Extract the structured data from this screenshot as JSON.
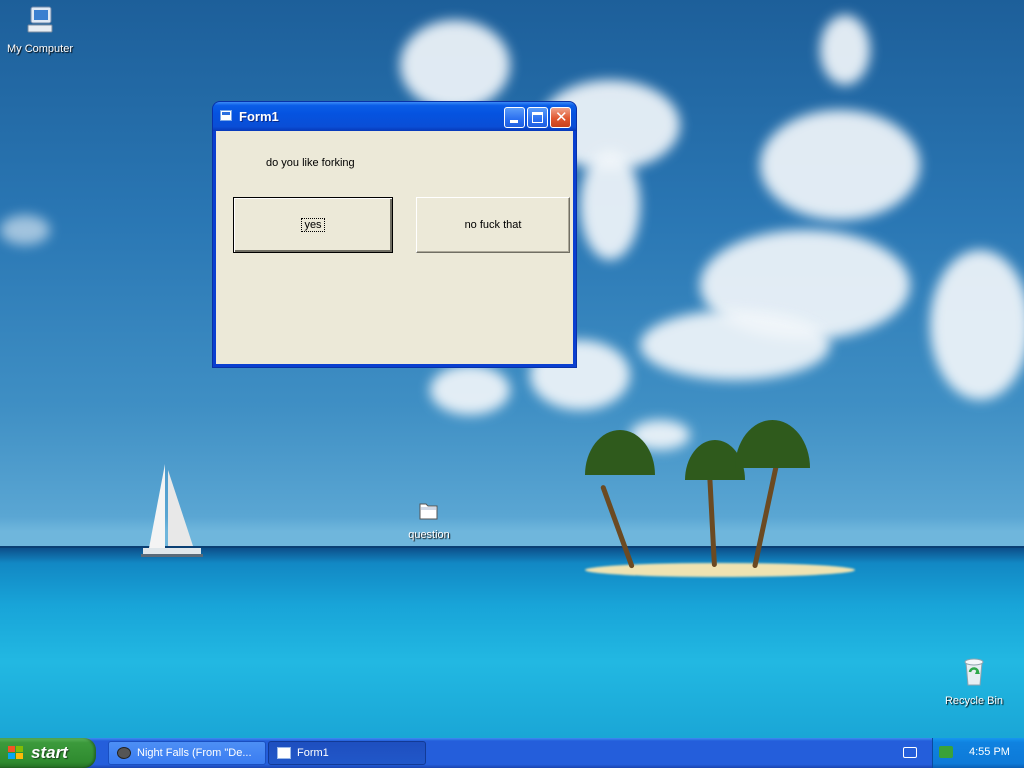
{
  "desktop": {
    "icons": [
      {
        "label": "My Computer",
        "icon": "my-computer-icon"
      },
      {
        "label": "question",
        "icon": "folder-icon"
      },
      {
        "label": "Recycle Bin",
        "icon": "recycle-bin-icon"
      }
    ]
  },
  "window": {
    "title": "Form1",
    "icon": "vb-form-icon",
    "prompt": "do you like forking",
    "buttons": {
      "yes": "yes",
      "no": "no fuck that"
    }
  },
  "taskbar": {
    "start_label": "start",
    "tasks": [
      {
        "label": "Night Falls (From \"De...",
        "icon": "media-player-icon",
        "active": false
      },
      {
        "label": "Form1",
        "icon": "vb-form-icon",
        "active": true
      }
    ],
    "clock": "4:55 PM"
  },
  "colors": {
    "titlebar": "#0553e0",
    "window_bg": "#ece9d8",
    "taskbar": "#245edb",
    "start_button": "#3c9a3c"
  }
}
